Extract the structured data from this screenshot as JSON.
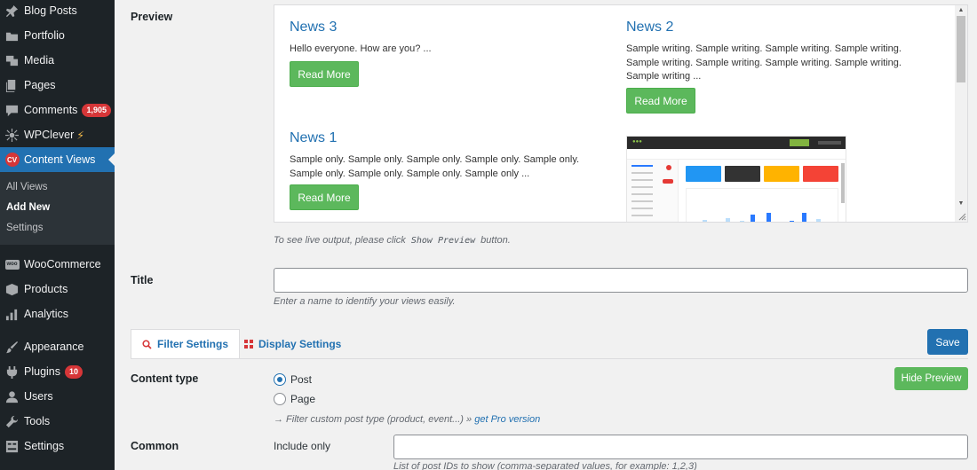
{
  "sidebar": {
    "items": [
      {
        "label": "Blog Posts",
        "icon": "pin-icon"
      },
      {
        "label": "Portfolio",
        "icon": "portfolio-icon"
      },
      {
        "label": "Media",
        "icon": "media-icon"
      },
      {
        "label": "Pages",
        "icon": "pages-icon"
      },
      {
        "label": "Comments",
        "icon": "comments-icon",
        "badge": "1,905"
      },
      {
        "label": "WPClever",
        "icon": "wpclever-icon",
        "suffix": "⚡"
      },
      {
        "label": "Content Views",
        "icon": "cv-icon",
        "icon_text": "CV"
      },
      {
        "label": "WooCommerce",
        "icon": "woocommerce-icon",
        "icon_text": "woo"
      },
      {
        "label": "Products",
        "icon": "products-icon"
      },
      {
        "label": "Analytics",
        "icon": "analytics-icon"
      },
      {
        "label": "Appearance",
        "icon": "appearance-icon"
      },
      {
        "label": "Plugins",
        "icon": "plugins-icon",
        "badge": "10"
      },
      {
        "label": "Users",
        "icon": "users-icon"
      },
      {
        "label": "Tools",
        "icon": "tools-icon"
      },
      {
        "label": "Settings",
        "icon": "settings-icon"
      }
    ],
    "submenu": [
      "All Views",
      "Add New",
      "Settings"
    ]
  },
  "preview": {
    "label": "Preview",
    "posts": [
      {
        "title": "News 3",
        "excerpt": "Hello everyone. How are you? ...",
        "button": "Read More"
      },
      {
        "title": "News 2",
        "excerpt": "Sample writing. Sample writing. Sample writing. Sample writing. Sample writing. Sample writing. Sample writing. Sample writing. Sample writing ...",
        "button": "Read More"
      },
      {
        "title": "News 1",
        "excerpt": "Sample only. Sample only. Sample only. Sample only. Sample only. Sample only. Sample only. Sample only. Sample only ...",
        "button": "Read More"
      }
    ],
    "hint_before": "To see live output, please click",
    "hint_code": "Show Preview",
    "hint_after": "button."
  },
  "title_field": {
    "label": "Title",
    "value": "",
    "hint": "Enter a name to identify your views easily."
  },
  "tabs": [
    {
      "label": "Filter Settings",
      "icon": "search-icon"
    },
    {
      "label": "Display Settings",
      "icon": "grid-icon"
    }
  ],
  "save_button": "Save",
  "hide_preview_button": "Hide Preview",
  "content_type": {
    "label": "Content type",
    "options": [
      "Post",
      "Page"
    ],
    "selected": "Post",
    "hint_before": "→ Filter custom post type (product, event...) »",
    "hint_link": "get Pro version"
  },
  "common": {
    "label": "Common",
    "include_label": "Include only",
    "include_value": "",
    "include_hint": "List of post IDs to show (comma-separated values, for example: 1,2,3)"
  },
  "colors": {
    "sidebar_bg": "#1d2327",
    "accent": "#2271b1",
    "green": "#5cb85c",
    "badge": "#d63638"
  }
}
